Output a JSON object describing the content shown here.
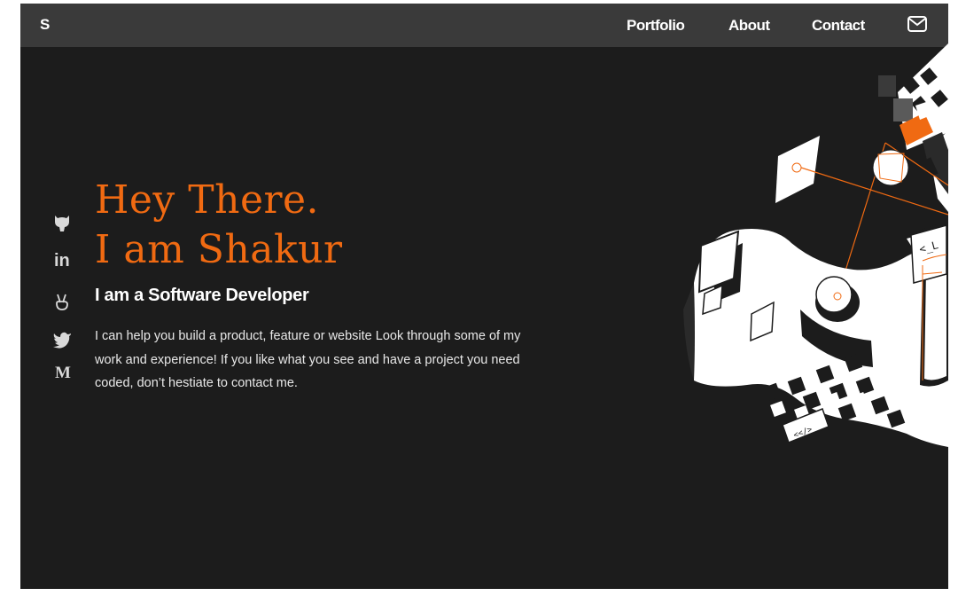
{
  "nav": {
    "brand": "S",
    "links": [
      "Portfolio",
      "About",
      "Contact"
    ],
    "mail_icon": "mail-icon"
  },
  "socials": [
    {
      "name": "github",
      "icon": "github-icon"
    },
    {
      "name": "linkedin",
      "icon": "linkedin-icon",
      "glyph": "in"
    },
    {
      "name": "angellist",
      "icon": "angellist-icon"
    },
    {
      "name": "twitter",
      "icon": "twitter-icon"
    },
    {
      "name": "medium",
      "icon": "medium-icon",
      "glyph": "M"
    }
  ],
  "hero": {
    "greeting": "Hey There.",
    "name_line": "I am Shakur",
    "subtitle": "I am a Software Developer",
    "description": "I can help you build a product, feature or website Look through some of my work and experience! If you like what you see and have a project you need coded, don’t hestiate to contact me.",
    "art_code_labels": [
      "<_L",
      "<</>"
    ]
  },
  "colors": {
    "accent": "#f06a12",
    "background": "#1c1c1c",
    "navbar": "#3a3a3a",
    "text": "#ffffff"
  }
}
